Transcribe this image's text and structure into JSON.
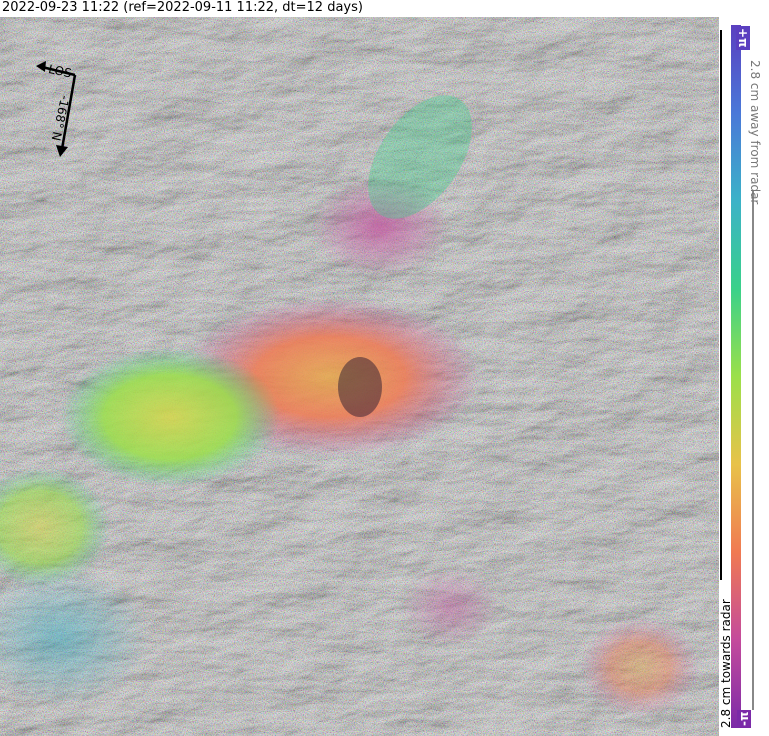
{
  "title": "2022-09-23 11:22 (ref=2022-09-11 11:22, dt=12 days)",
  "compass": {
    "los_label": "LOS",
    "heading_label": "-168° N"
  },
  "colorbar": {
    "top_label": "+π",
    "bottom_label": "-π",
    "away_label": "2.8 cm away from radar",
    "towards_label": "2.8 cm towards radar",
    "colors": [
      "#7b2aa8",
      "#c44a9c",
      "#f07a52",
      "#e8c24a",
      "#9be04a",
      "#3ad18a",
      "#3bb2c8",
      "#4a78d8",
      "#5a3fc0"
    ]
  }
}
